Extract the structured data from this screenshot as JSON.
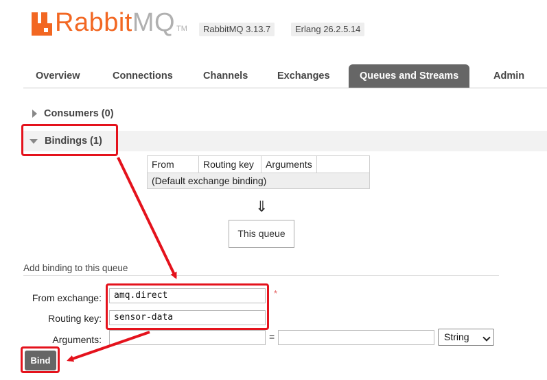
{
  "header": {
    "logo_rabbit": "Rabbit",
    "logo_mq": "MQ",
    "logo_tm": "TM",
    "version": "RabbitMQ 3.13.7",
    "erlang": "Erlang 26.2.5.14"
  },
  "tabs": [
    {
      "label": "Overview"
    },
    {
      "label": "Connections"
    },
    {
      "label": "Channels"
    },
    {
      "label": "Exchanges"
    },
    {
      "label": "Queues and Streams",
      "active": true
    },
    {
      "label": "Admin"
    }
  ],
  "sections": {
    "consumers": "Consumers (0)",
    "bindings": "Bindings (1)"
  },
  "bindings_table": {
    "headers": [
      "From",
      "Routing key",
      "Arguments",
      ""
    ],
    "default_row": "(Default exchange binding)"
  },
  "flow": {
    "arrow": "⇓",
    "this_queue": "This queue"
  },
  "add_binding": {
    "title": "Add binding to this queue",
    "from_exchange_label": "From exchange:",
    "from_exchange_value": "amq.direct",
    "required_marker": "*",
    "routing_key_label": "Routing key:",
    "routing_key_value": "sensor-data",
    "arguments_label": "Arguments:",
    "arguments_key_value": "",
    "equals": "=",
    "arguments_value": "",
    "arguments_type": "String",
    "bind_button": "Bind"
  },
  "colors": {
    "brand_orange": "#f26722",
    "tab_active": "#666666",
    "highlight_red": "#e4121c"
  }
}
